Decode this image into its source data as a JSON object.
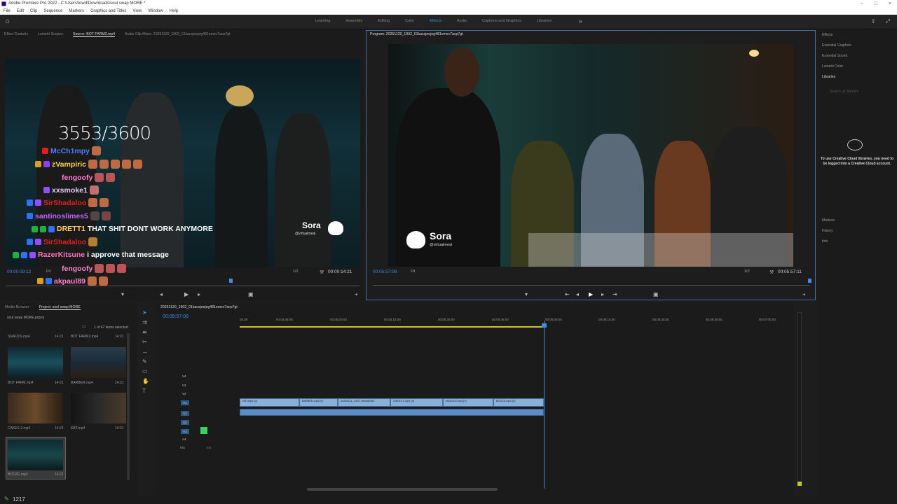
{
  "app": {
    "title": "Adobe Premiere Pro 2022 - C:\\Users\\lowd\\Downloads\\soul swap MORE *"
  },
  "menu": [
    "File",
    "Edit",
    "Clip",
    "Sequence",
    "Markers",
    "Graphics and Titles",
    "View",
    "Window",
    "Help"
  ],
  "workspaces": {
    "tabs": [
      "Learning",
      "Assembly",
      "Editing",
      "Color",
      "Effects",
      "Audio",
      "Captions and Graphics",
      "Libraries"
    ],
    "active": "Effects"
  },
  "source": {
    "tabs": [
      "Effect Controls",
      "Lumetri Scopes",
      "Source: BOT FARM2.mp4",
      "Audio Clip Mixer: 20251120_1902_01kacsjoejeg481emxv7acp7gt"
    ],
    "active_tab": "Source: BOT FARM2.mp4",
    "counter": "3553/3600",
    "chat": [
      {
        "name": "McCh1mpy",
        "color": "#4a7dff",
        "msg": ""
      },
      {
        "name": "zVampiric",
        "color": "#ffd24a",
        "msg": ""
      },
      {
        "name": "fengoofy",
        "color": "#ff7fd0",
        "msg": ""
      },
      {
        "name": "xxsmoke1",
        "color": "#e6c8ff",
        "msg": ""
      },
      {
        "name": "SirShadaloo",
        "color": "#e02020",
        "msg": ""
      },
      {
        "name": "santinoslimes5",
        "color": "#c060ff",
        "msg": ""
      },
      {
        "name": "DRETT1",
        "color": "#ffcc66",
        "msg": "THAT SHIT DONT WORK ANYMORE"
      },
      {
        "name": "SirShadaloo",
        "color": "#e02020",
        "msg": ""
      },
      {
        "name": "RazerKitsune",
        "color": "#ff70c0",
        "msg": "i approve that message"
      },
      {
        "name": "fengoofy",
        "color": "#ff7fd0",
        "msg": ""
      },
      {
        "name": "akpaul89",
        "color": "#ff7fd0",
        "msg": ""
      }
    ],
    "watermark": {
      "name": "Sora",
      "handle": "@virtualmeal"
    },
    "timecode": "00:00:09:12",
    "fit": "Fit",
    "ratio": "1/2",
    "duration": "00:00:14:21"
  },
  "program": {
    "title": "Program: 20251120_1902_01kacsjoejeg481emxv7acp7gt",
    "watermark": {
      "name": "Sora",
      "handle": "@virtualmeal"
    },
    "timecode": "00:05:57:08",
    "fit": "Fit",
    "ratio": "1/2",
    "duration": "00:05:57:11"
  },
  "right_panel": {
    "items": [
      "Effects",
      "Essential Graphics",
      "Essential Sound",
      "Lumetri Color",
      "Libraries"
    ],
    "search_placeholder": "Search all libraries",
    "cc_message": "To use Creative Cloud libraries, you need to be logged into a Creative Cloud account.",
    "lower_items": [
      "Markers",
      "History",
      "Info"
    ]
  },
  "project": {
    "tabs": [
      "Media Browser",
      "Project: soul swap MORE"
    ],
    "file": "soul swap MORE.prproj",
    "count": "1 of 47 items selected",
    "items": [
      {
        "name": "SNACKS.mp4",
        "dur": "14:21"
      },
      {
        "name": "BOT FARM2.mp4",
        "dur": "14:21"
      },
      {
        "name": "BOT FARM.mp4",
        "dur": "14:21"
      },
      {
        "name": "BARBER.mp4",
        "dur": "14:21"
      },
      {
        "name": "CAKES 2.mp4",
        "dur": "14:21"
      },
      {
        "name": "EBT.mp4",
        "dur": "14:21"
      },
      {
        "name": "BOOZE.mp4",
        "dur": "14:21"
      }
    ]
  },
  "timeline": {
    "title": "20251120_1902_01kacsjoejeg481emxv7acp7gt",
    "timecode": "00:05:57:08",
    "ruler": [
      "00:00",
      "00:04:45:00",
      "00:05:00:00",
      "00:05:15:00",
      "00:05:30:00",
      "00:05:45:00",
      "00:06:00:00",
      "00:06:15:00",
      "00:06:30:00",
      "00:06:45:00",
      "00:07:00:00"
    ],
    "video_tracks": [
      "V4",
      "V3",
      "V2",
      "V1"
    ],
    "audio_tracks": [
      "A1",
      "A2",
      "A3",
      "A4"
    ],
    "mix_label": "Mix",
    "mix_value": "0.0",
    "clips": [
      "EBT.mp4 [V]",
      "BARBER.mp4 [V]",
      "20250121_0310_bbbe8c5d2",
      "CAKES 2.mp4 [V]",
      "SNACKS.mp4 [V]",
      "BOOZE.mp4 [V]"
    ]
  },
  "status": {
    "value": "1217"
  }
}
